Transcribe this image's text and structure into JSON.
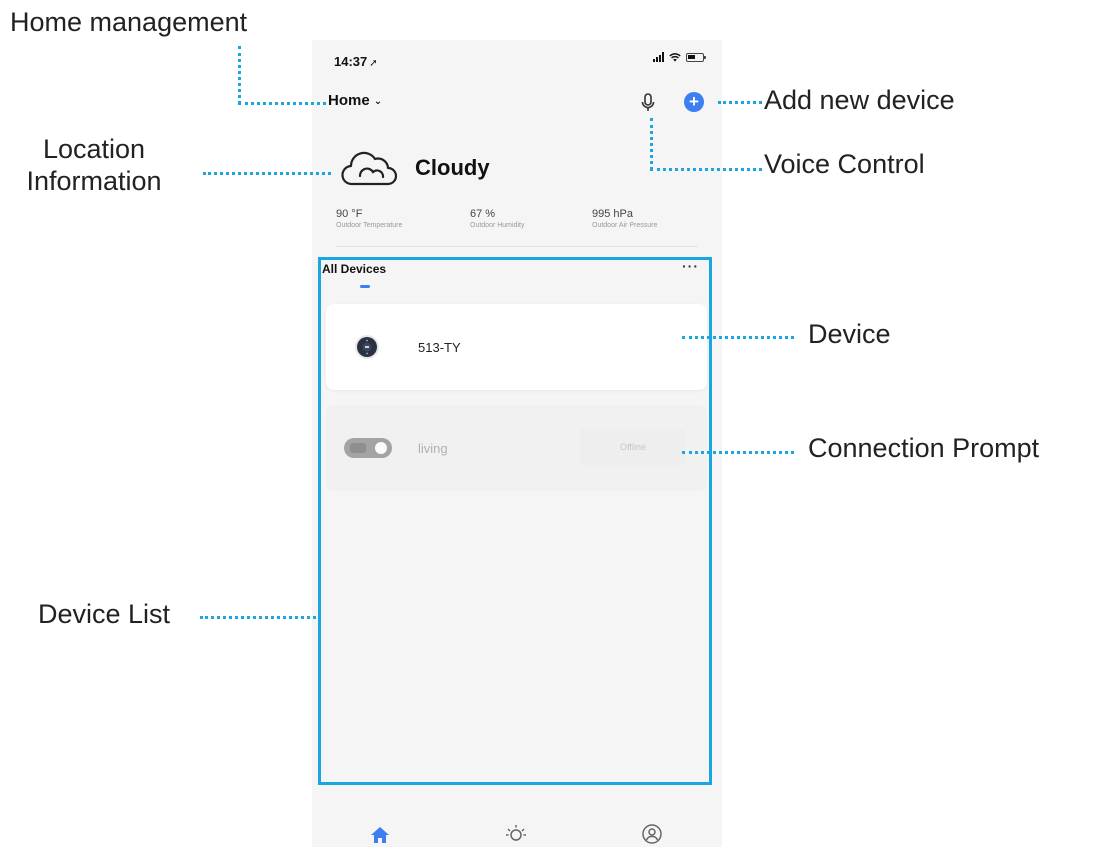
{
  "status_bar": {
    "time": "14:37",
    "location_glyph": "➚"
  },
  "header": {
    "home_label": "Home",
    "home_chevron": "⌄",
    "mic_icon": "microphone-icon",
    "add_icon": "plus-icon",
    "add_glyph": "+"
  },
  "weather": {
    "condition": "Cloudy",
    "icon": "cloud-icon",
    "metrics": [
      {
        "value": "90 °F",
        "label": "Outdoor Temperature"
      },
      {
        "value": "67 %",
        "label": "Outdoor Humidity"
      },
      {
        "value": "995 hPa",
        "label": "Outdoor Air Pressure"
      }
    ]
  },
  "device_list": {
    "tab_label": "All Devices",
    "more_glyph": "···",
    "devices": [
      {
        "name": "513-TY",
        "icon": "thermostat-icon",
        "status": "online"
      },
      {
        "name": "living",
        "icon": "smart-switch-icon",
        "status": "offline",
        "status_text": "Offline"
      }
    ]
  },
  "tab_bar": {
    "tabs": [
      {
        "icon": "home-icon",
        "active": true
      },
      {
        "icon": "scene-sun-icon",
        "active": false
      },
      {
        "icon": "profile-icon",
        "active": false
      }
    ]
  },
  "annotations": {
    "home_management": "Home management",
    "location_information_line1": "Location",
    "location_information_line2": "Information",
    "add_new_device": "Add new device",
    "voice_control": "Voice Control",
    "device": "Device",
    "connection_prompt": "Connection Prompt",
    "device_list": "Device List"
  },
  "colors": {
    "accent": "#3b7ff3",
    "annotation_line": "#1aa7e0",
    "screen_background": "#f5f5f5"
  }
}
